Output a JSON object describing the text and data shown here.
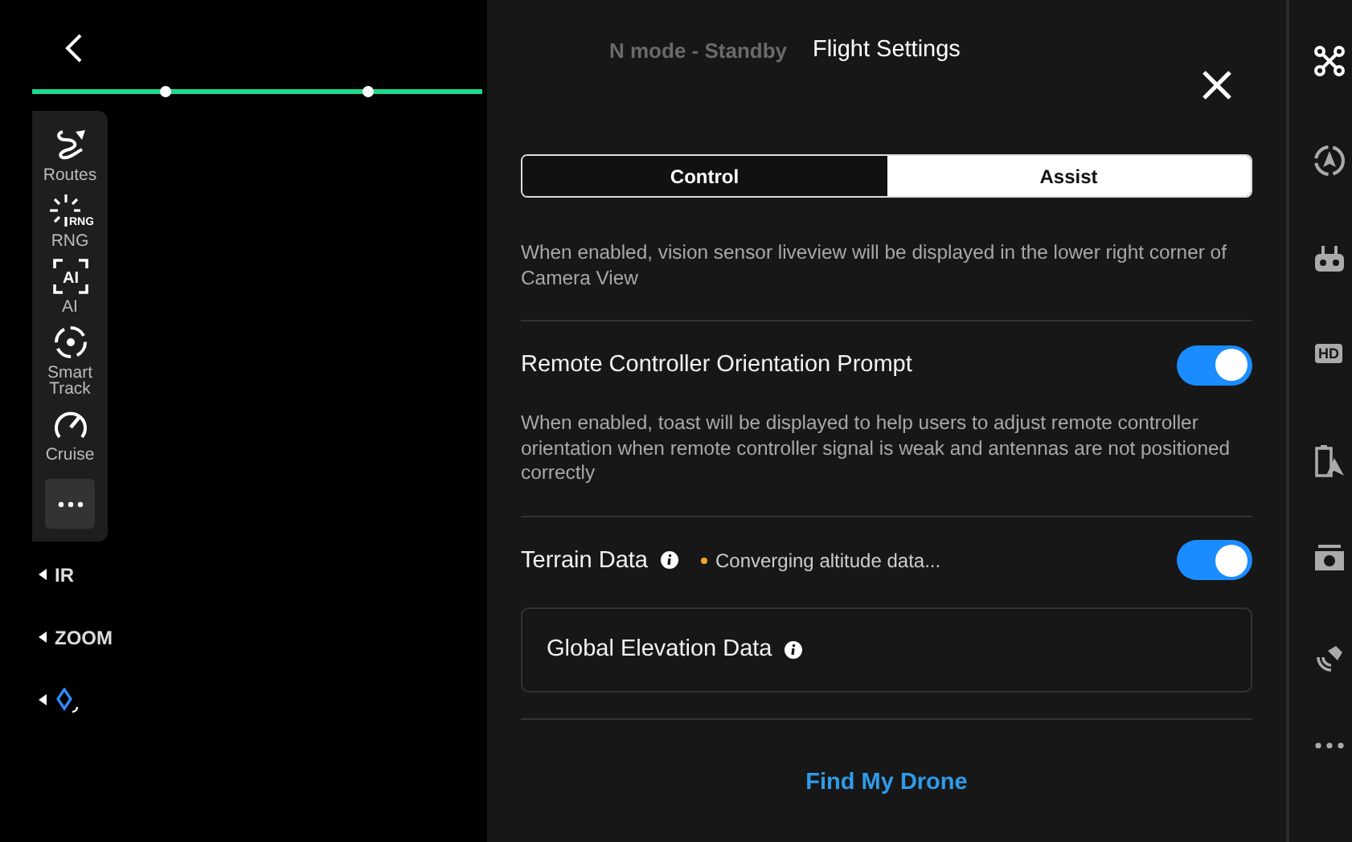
{
  "background_status": "N mode - Standby",
  "tools": [
    {
      "kind": "routes",
      "label": "Routes"
    },
    {
      "kind": "rng",
      "label": "RNG",
      "icon_text": "RNG"
    },
    {
      "kind": "ai",
      "label": "AI",
      "icon_text": "AI"
    },
    {
      "kind": "track",
      "label": "Smart Track"
    },
    {
      "kind": "cruise",
      "label": "Cruise"
    },
    {
      "kind": "more"
    }
  ],
  "lens_buttons": [
    "IR",
    "ZOOM"
  ],
  "panel": {
    "title": "Flight Settings",
    "tabs": [
      {
        "label": "Control",
        "selected": false
      },
      {
        "label": "Assist",
        "selected": true
      }
    ],
    "intro": "When enabled, vision sensor liveview will be displayed in the lower right corner of Camera View",
    "settings": [
      {
        "label": "Remote Controller Orientation Prompt",
        "on": true,
        "description": "When enabled, toast will be displayed to help users to adjust remote controller orientation when remote controller signal is weak and antennas are not positioned correctly"
      },
      {
        "label": "Terrain Data",
        "info": true,
        "status": "Converging altitude data...",
        "on": true
      }
    ],
    "card": {
      "label": "Global Elevation Data",
      "info": true
    },
    "link": "Find My Drone"
  },
  "right_rail": [
    {
      "kind": "drone"
    },
    {
      "kind": "nav"
    },
    {
      "kind": "remote"
    },
    {
      "kind": "hd",
      "label": "HD"
    },
    {
      "kind": "battery"
    },
    {
      "kind": "camera"
    },
    {
      "kind": "satellite"
    },
    {
      "kind": "more"
    }
  ]
}
